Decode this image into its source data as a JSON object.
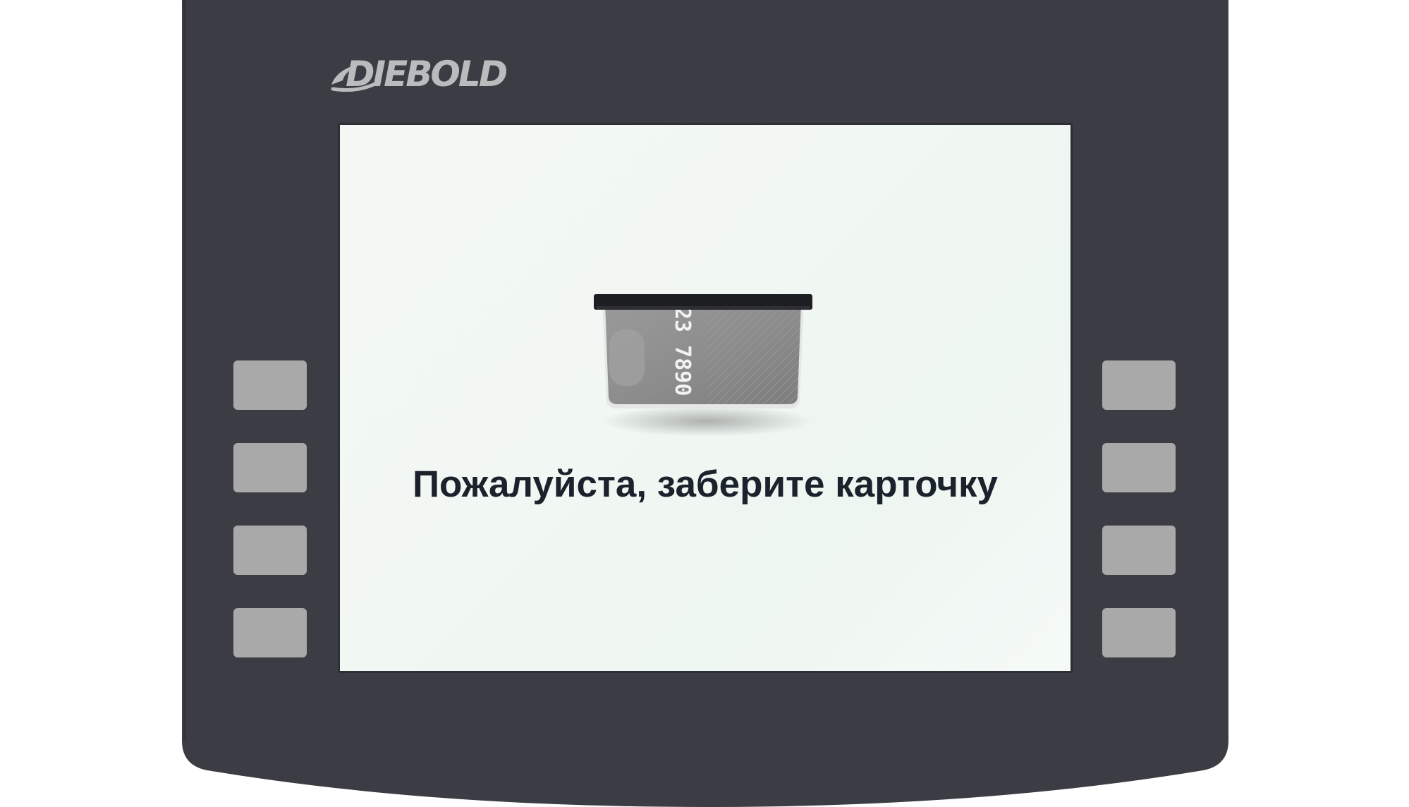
{
  "brand": {
    "logo_text": "DIEBOLD",
    "logo_color": "#b9bbbd"
  },
  "colors": {
    "bezel": "#3c3d44",
    "screen_background": "#f1f7f3",
    "button": "#a9a9a9",
    "prompt_text": "#1b222c"
  },
  "screen": {
    "message": "Пожалуйста, заберите карточку",
    "card_number_visible": "23 7890",
    "illustration": "card-ejecting-from-slot-icon"
  },
  "function_keys": {
    "left": [
      "",
      "",
      "",
      ""
    ],
    "right": [
      "",
      "",
      "",
      ""
    ]
  }
}
